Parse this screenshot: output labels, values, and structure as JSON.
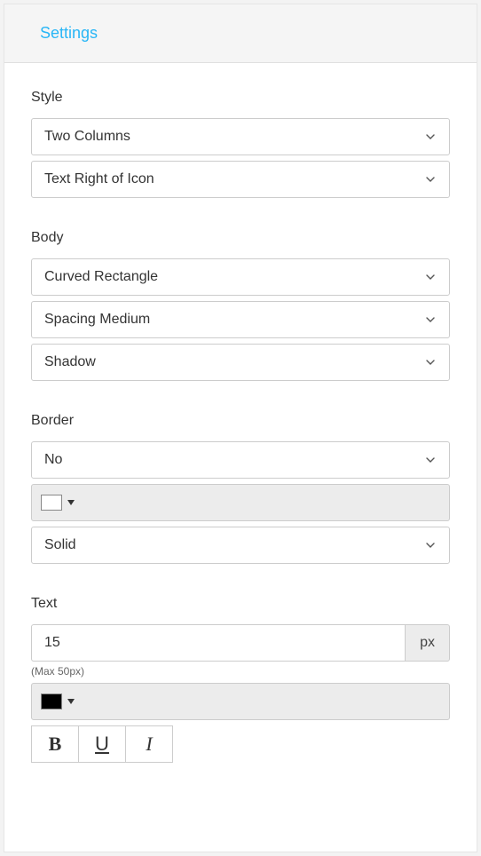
{
  "header": {
    "title": "Settings"
  },
  "sections": {
    "style": {
      "label": "Style",
      "columns": "Two Columns",
      "position": "Text Right of Icon"
    },
    "body": {
      "label": "Body",
      "shape": "Curved Rectangle",
      "spacing": "Spacing Medium",
      "shadow": "Shadow"
    },
    "border": {
      "label": "Border",
      "enabled": "No",
      "color": "#ffffff",
      "style": "Solid"
    },
    "text": {
      "label": "Text",
      "size": "15",
      "unit": "px",
      "hint": "(Max 50px)",
      "color": "#000000",
      "bold_label": "B",
      "underline_label": "U",
      "italic_label": "I"
    }
  }
}
